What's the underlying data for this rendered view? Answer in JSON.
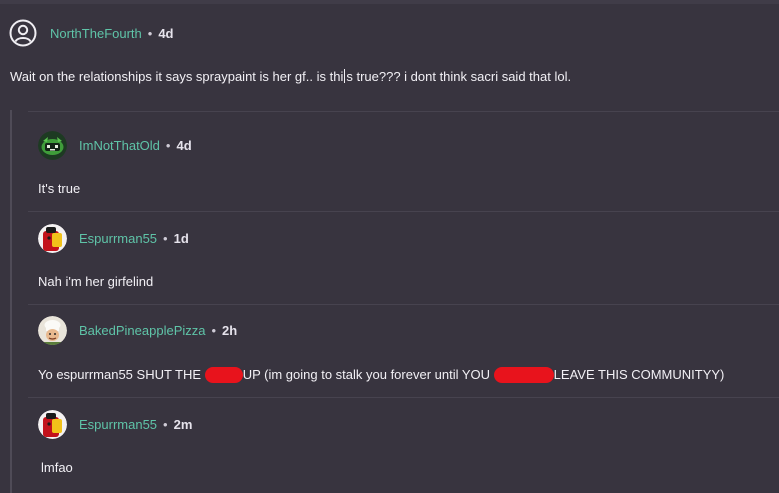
{
  "post": {
    "username": "NorthTheFourth",
    "separator": "•",
    "time": "4d",
    "body_before_caret": "Wait on the relationships it says spraypaint is her gf.. is thi",
    "body_after_caret": "s true??? i dont think sacri said that lol."
  },
  "replies": [
    {
      "username": "ImNotThatOld",
      "separator": "•",
      "time": "4d",
      "body": "It's true"
    },
    {
      "username": "Espurrman55",
      "separator": "•",
      "time": "1d",
      "body": "Nah i'm her girfelind"
    },
    {
      "username": "BakedPineapplePizza",
      "separator": "•",
      "time": "2h",
      "body_part1": "Yo espurrman55 SHUT THE",
      "body_part2": "UP (im going to stalk you forever until YOU",
      "body_part3": "LEAVE THIS COMMUNITYY)"
    },
    {
      "username": "Espurrman55",
      "separator": "•",
      "time": "2m",
      "body": "lmfao"
    }
  ],
  "colors": {
    "background": "#38343f",
    "username": "#5fc4a8",
    "redaction": "#e8131c"
  },
  "icons": {
    "post_avatar": "user-outline-icon",
    "reply1_avatar": "green-creature-avatar",
    "reply2_avatar": "red-yellow-character-avatar",
    "reply3_avatar": "chef-character-avatar",
    "reply4_avatar": "red-yellow-character-avatar"
  }
}
